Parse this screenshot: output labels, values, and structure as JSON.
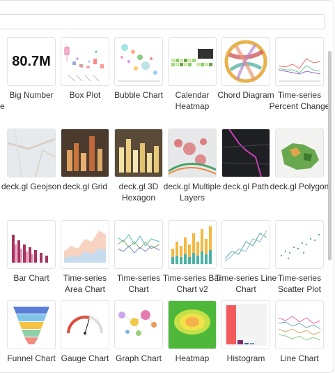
{
  "search": {
    "placeholder": ""
  },
  "edge_fragment": "e",
  "big_number_value": "80.7M",
  "tiles": {
    "big_number": "Big Number",
    "box_plot": "Box Plot",
    "bubble_chart": "Bubble Chart",
    "calendar_heatmap": "Calendar Heatmap",
    "chord_diagram": "Chord Diagram",
    "ts_percent_change": "Time-series Percent Change",
    "deckgl_geojson": "deck.gl Geojson",
    "deckgl_grid": "deck.gl Grid",
    "deckgl_3d_hexagon": "deck.gl 3D Hexagon",
    "deckgl_multiple_layers": "deck.gl Multiple Layers",
    "deckgl_path": "deck.gl Path",
    "deckgl_polygon": "deck.gl Polygon",
    "bar_chart": "Bar Chart",
    "ts_area_chart": "Time-series Area Chart",
    "ts_chart": "Time-series Chart",
    "ts_bar_chart_v2": "Time-series Bar Chart v2",
    "ts_line_chart": "Time-series Line Chart",
    "ts_scatter_plot": "Time-series Scatter Plot",
    "funnel_chart": "Funnel Chart",
    "gauge_chart": "Gauge Chart",
    "graph_chart": "Graph Chart",
    "heatmap": "Heatmap",
    "histogram": "Histogram",
    "line_chart": "Line Chart"
  },
  "colors": {
    "accent": "#1fa8c9",
    "border": "#e3e3e3"
  }
}
